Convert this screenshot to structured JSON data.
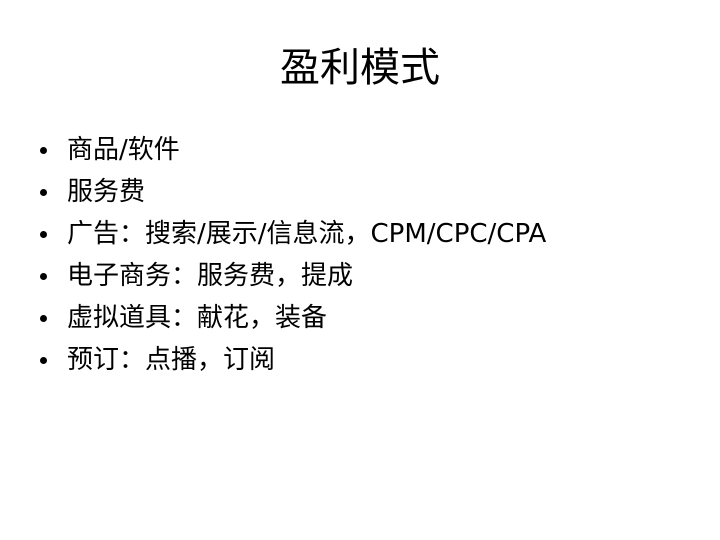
{
  "slide": {
    "title": "盈利模式",
    "bullets": [
      "商品/软件",
      "服务费",
      "广告：搜索/展示/信息流，CPM/CPC/CPA",
      "电子商务：服务费，提成",
      "虚拟道具：献花，装备",
      "预订：点播，订阅"
    ]
  }
}
